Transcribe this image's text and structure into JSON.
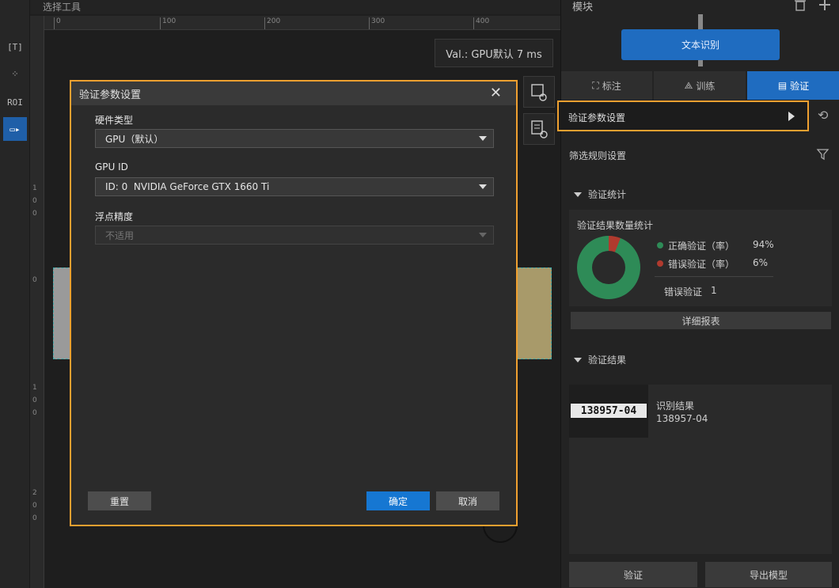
{
  "canvas": {
    "header_title": "选择工具",
    "ruler_top_ticks": [
      "0",
      "100",
      "200",
      "300",
      "400"
    ],
    "ruler_left_numbers": [
      [
        "1",
        "0",
        "0"
      ],
      [
        "0"
      ],
      [
        "1",
        "0",
        "0"
      ],
      [
        "2",
        "0",
        "0"
      ]
    ],
    "val_text": "Val.: GPU默认 7 ms"
  },
  "toolbar": {
    "items": [
      {
        "name": "text-tool-icon",
        "glyph": "[T]"
      },
      {
        "name": "node-tool-icon",
        "glyph": "⁘"
      },
      {
        "name": "roi-tool-icon",
        "glyph": "ROI"
      },
      {
        "name": "select-tool-icon",
        "glyph": "▭▸"
      }
    ]
  },
  "dialog": {
    "title": "验证参数设置",
    "close": "✕",
    "hardware_label": "硬件类型",
    "hardware_value": "GPU（默认）",
    "gpu_id_label": "GPU ID",
    "gpu_id_value": "ID: 0  NVIDIA GeForce GTX 1660 Ti",
    "precision_label": "浮点精度",
    "precision_value": "不适用",
    "reset_label": "重置",
    "ok_label": "确定",
    "cancel_label": "取消"
  },
  "right_panel": {
    "module_title": "模块",
    "node_label": "文本识别",
    "tabs": [
      {
        "label": "标注",
        "icon": "⛶"
      },
      {
        "label": "训练",
        "icon": "⟁"
      },
      {
        "label": "验证",
        "icon": "▤"
      }
    ],
    "verify_setting_label": "验证参数设置",
    "history_icon": "⟲",
    "filter_label": "筛选规则设置",
    "stats_section": "验证统计",
    "stats_title": "验证结果数量统计",
    "correct_label": "正确验证（率）",
    "correct_value": "94%",
    "wrong_label": "错误验证（率）",
    "wrong_value": "6%",
    "wrong_count_label": "错误验证",
    "wrong_count_value": "1",
    "detail_button": "详细报表",
    "results_section": "验证结果",
    "result_title": "识别结果",
    "result_value": "138957-04",
    "thumb_text": "138957-04",
    "verify_button": "验证",
    "export_button": "导出模型",
    "colors": {
      "accent": "#1f6cc0",
      "highlight": "#f0a030",
      "correct": "#2e8b57",
      "wrong": "#b03a2e"
    },
    "correct_fraction": 0.94
  }
}
